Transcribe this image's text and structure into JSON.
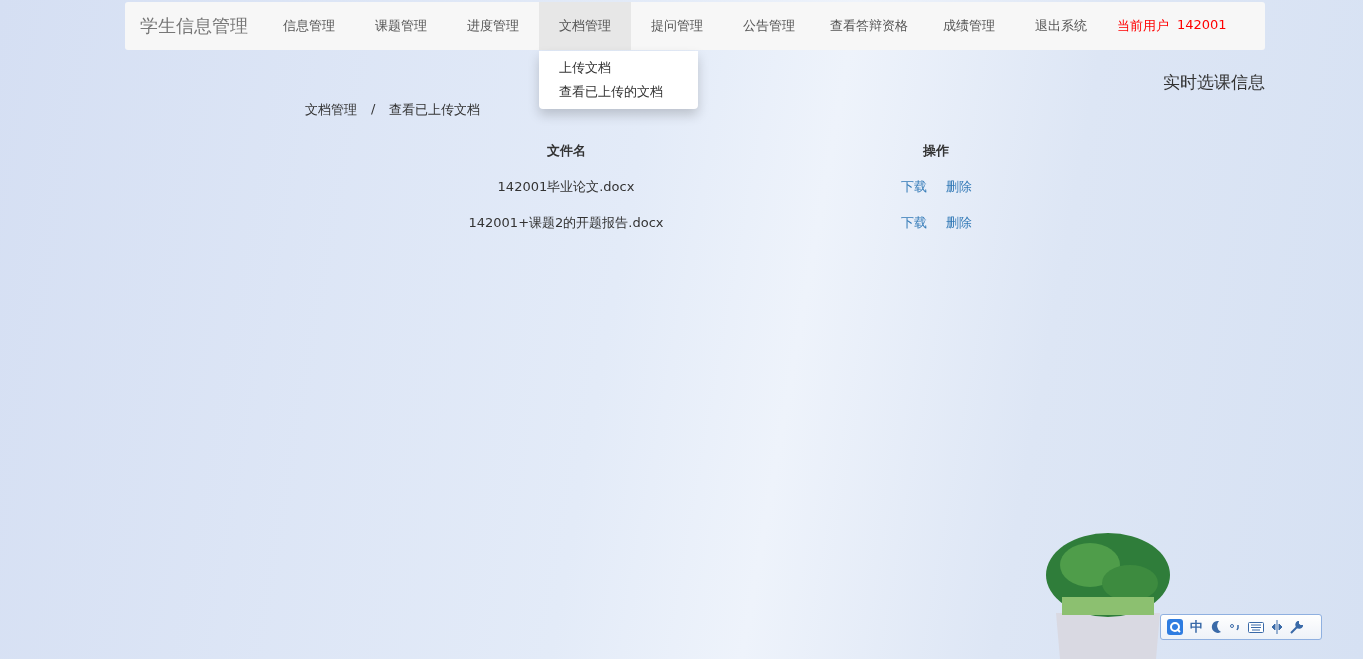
{
  "navbar": {
    "brand": "学生信息管理",
    "items": [
      {
        "label": "信息管理",
        "selected": false
      },
      {
        "label": "课题管理",
        "selected": false
      },
      {
        "label": "进度管理",
        "selected": false
      },
      {
        "label": "文档管理",
        "selected": true,
        "menu": [
          "上传文档",
          "查看已上传的文档"
        ]
      },
      {
        "label": "提问管理",
        "selected": false
      },
      {
        "label": "公告管理",
        "selected": false
      },
      {
        "label": "查看答辩资格",
        "selected": false
      },
      {
        "label": "成绩管理",
        "selected": false
      },
      {
        "label": "退出系统",
        "selected": false
      }
    ],
    "user_label": "当前用户",
    "user_id": "142001"
  },
  "side_title": "实时选课信息",
  "breadcrumb": [
    "文档管理",
    "查看已上传文档"
  ],
  "breadcrumb_separator": "/",
  "table": {
    "columns": [
      "文件名",
      "操作"
    ],
    "rows": [
      {
        "file": "142001毕业论文.docx",
        "actions": [
          "下载",
          "删除"
        ]
      },
      {
        "file": "142001+课题2的开题报告.docx",
        "actions": [
          "下载",
          "删除"
        ]
      }
    ]
  },
  "ime_toolbar": {
    "mode": "中"
  }
}
